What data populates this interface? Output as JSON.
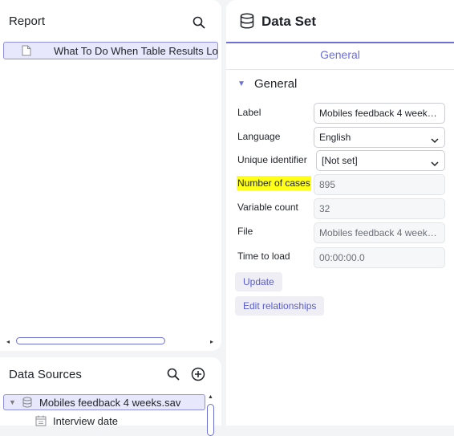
{
  "report": {
    "title": "Report",
    "items": [
      {
        "label": "What To Do When Table Results Lo"
      }
    ]
  },
  "data_sources": {
    "title": "Data Sources",
    "items": [
      {
        "label": "Mobiles feedback 4 weeks.sav"
      },
      {
        "label": "Interview date"
      }
    ]
  },
  "dataset": {
    "title": "Data Set",
    "tab": "General",
    "section": "General",
    "fields": {
      "label": {
        "label": "Label",
        "value": "Mobiles feedback 4 weeks.sav"
      },
      "language": {
        "label": "Language",
        "value": "English"
      },
      "unique_identifier": {
        "label": "Unique identifier",
        "value": "[Not set]"
      },
      "number_of_cases": {
        "label": "Number of cases",
        "value": "895"
      },
      "variable_count": {
        "label": "Variable count",
        "value": "32"
      },
      "file": {
        "label": "File",
        "value": "Mobiles feedback 4 weeks.sav"
      },
      "time_to_load": {
        "label": "Time to load",
        "value": "00:00:00.0"
      }
    },
    "buttons": {
      "update": "Update",
      "edit_relationships": "Edit relationships"
    }
  },
  "colors": {
    "accent": "#6c6fd6",
    "selection_bg": "#e7e8fb",
    "highlight": "#ffff1a"
  }
}
